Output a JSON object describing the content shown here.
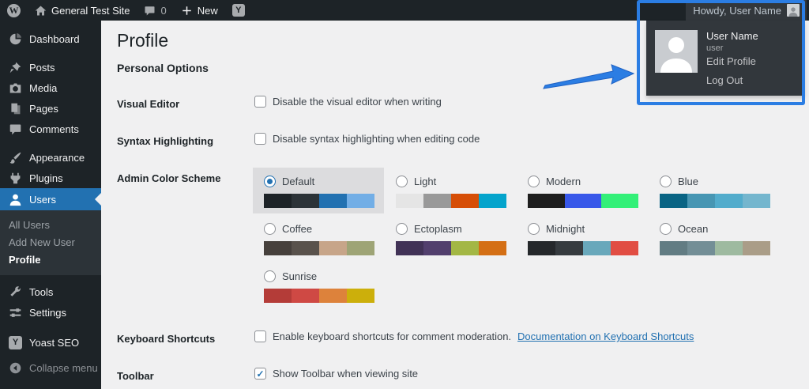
{
  "topbar": {
    "site_name": "General Test Site",
    "comment_count": "0",
    "new_label": "New",
    "howdy": "Howdy, User Name"
  },
  "user_menu": {
    "display_name": "User Name",
    "username": "user",
    "edit_profile": "Edit Profile",
    "log_out": "Log Out"
  },
  "sidebar": {
    "items": [
      {
        "label": "Dashboard"
      },
      {
        "label": "Posts"
      },
      {
        "label": "Media"
      },
      {
        "label": "Pages"
      },
      {
        "label": "Comments"
      },
      {
        "label": "Appearance"
      },
      {
        "label": "Plugins"
      },
      {
        "label": "Users",
        "active": true
      },
      {
        "label": "Tools"
      },
      {
        "label": "Settings"
      },
      {
        "label": "Yoast SEO"
      },
      {
        "label": "Collapse menu"
      }
    ],
    "users_submenu": [
      {
        "label": "All Users"
      },
      {
        "label": "Add New User"
      },
      {
        "label": "Profile",
        "current": true
      }
    ]
  },
  "main": {
    "title": "Profile",
    "section": "Personal Options",
    "rows": {
      "visual_editor": {
        "label": "Visual Editor",
        "option": "Disable the visual editor when writing",
        "checked": false
      },
      "syntax_highlighting": {
        "label": "Syntax Highlighting",
        "option": "Disable syntax highlighting when editing code",
        "checked": false
      },
      "admin_color_scheme": {
        "label": "Admin Color Scheme",
        "schemes": [
          {
            "name": "Default",
            "selected": true,
            "colors": [
              "#1d2327",
              "#2c3338",
              "#2271b1",
              "#72aee6"
            ]
          },
          {
            "name": "Light",
            "selected": false,
            "colors": [
              "#e5e5e5",
              "#999999",
              "#d64e07",
              "#04a4cc"
            ]
          },
          {
            "name": "Modern",
            "selected": false,
            "colors": [
              "#1e1e1e",
              "#3858e9",
              "#33f078"
            ]
          },
          {
            "name": "Blue",
            "selected": false,
            "colors": [
              "#096484",
              "#4796b3",
              "#52accc",
              "#74b6ce"
            ]
          },
          {
            "name": "Coffee",
            "selected": false,
            "colors": [
              "#46403c",
              "#59524c",
              "#c7a589",
              "#9ea476"
            ]
          },
          {
            "name": "Ectoplasm",
            "selected": false,
            "colors": [
              "#413256",
              "#523f6d",
              "#a3b745",
              "#d46f15"
            ]
          },
          {
            "name": "Midnight",
            "selected": false,
            "colors": [
              "#25282b",
              "#363b3f",
              "#69a8bb",
              "#e14d43"
            ]
          },
          {
            "name": "Ocean",
            "selected": false,
            "colors": [
              "#627c83",
              "#738e96",
              "#9ebaa0",
              "#aa9d88"
            ]
          },
          {
            "name": "Sunrise",
            "selected": false,
            "colors": [
              "#b43c38",
              "#cf4944",
              "#dd823b",
              "#ccaf0b"
            ]
          }
        ]
      },
      "keyboard_shortcuts": {
        "label": "Keyboard Shortcuts",
        "option": "Enable keyboard shortcuts for comment moderation.",
        "link": "Documentation on Keyboard Shortcuts",
        "checked": false
      },
      "toolbar": {
        "label": "Toolbar",
        "option": "Show Toolbar when viewing site",
        "checked": true
      }
    }
  },
  "icons": {
    "wordpress_logo": "W",
    "yoast_logo": "Y",
    "new_plus": "+",
    "check_glyph": "✓"
  },
  "colors": {
    "admin_bar_bg": "#1d2327",
    "submenu_bg": "#2c3338",
    "active_item_bg": "#2271b1",
    "content_bg": "#f0f0f1",
    "selected_scheme_bg": "#dcdcde",
    "link": "#2271b1",
    "annotation_blue": "#2b7de3"
  }
}
